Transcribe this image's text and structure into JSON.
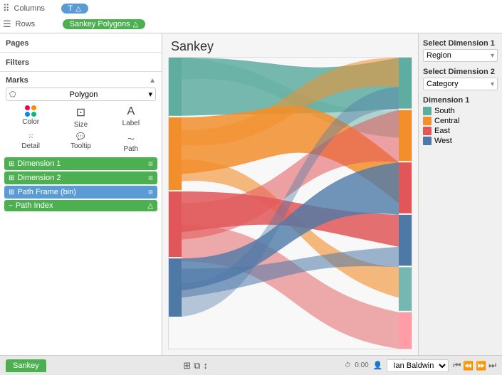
{
  "toolbar": {
    "columns_label": "Columns",
    "columns_pill": "T",
    "columns_delta": "△",
    "rows_label": "Rows",
    "rows_pill": "Sankey Polygons",
    "rows_delta": "△"
  },
  "left": {
    "pages_title": "Pages",
    "filters_title": "Filters",
    "marks_title": "Marks",
    "marks_type": "Polygon",
    "buttons": {
      "color": "Color",
      "size": "Size",
      "label": "Label",
      "detail": "Detail",
      "tooltip": "Tooltip",
      "path": "Path"
    },
    "fields": [
      {
        "name": "Dimension 1",
        "type": "green",
        "icon": "⊞",
        "hasMenu": true
      },
      {
        "name": "Dimension 2",
        "type": "green",
        "icon": "⊞",
        "hasMenu": true
      },
      {
        "name": "Path Frame (bin)",
        "type": "blue",
        "icon": "⊞",
        "hasMenu": true
      },
      {
        "name": "Path Index",
        "type": "green",
        "icon": "~",
        "hasDelta": true
      }
    ]
  },
  "chart": {
    "title": "Sankey"
  },
  "right": {
    "dim1_label": "Select Dimension 1",
    "dim1_value": "Region",
    "dim2_label": "Select Dimension 2",
    "dim2_value": "Category",
    "legend_title": "Dimension 1",
    "legend_items": [
      {
        "name": "South",
        "color": "#5fada0"
      },
      {
        "name": "Central",
        "color": "#f28e2b"
      },
      {
        "name": "East",
        "color": "#e15759"
      },
      {
        "name": "West",
        "color": "#4e79a7"
      }
    ]
  },
  "bottom": {
    "tab_label": "Sankey",
    "status": "0:00",
    "user": "Ian Baldwin",
    "nav_icons": [
      "◀◀",
      "◀",
      "▶",
      "▶▶"
    ]
  }
}
